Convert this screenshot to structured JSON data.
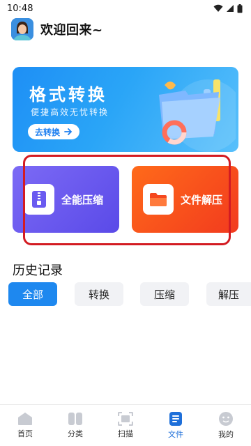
{
  "status_bar": {
    "time": "10:48"
  },
  "header": {
    "greeting": "欢迎回来~"
  },
  "banner": {
    "title": "格式转换",
    "subtitle": "便捷高效无忧转换",
    "cta_label": "去转换"
  },
  "features": [
    {
      "label": "全能压缩",
      "icon": "zip-file-icon"
    },
    {
      "label": "文件解压",
      "icon": "folder-icon"
    }
  ],
  "history": {
    "title": "历史记录",
    "filters": [
      "全部",
      "转换",
      "压缩",
      "解压"
    ],
    "active_filter": "全部"
  },
  "bottom_nav": {
    "items": [
      {
        "label": "首页",
        "icon": "home-icon"
      },
      {
        "label": "分类",
        "icon": "category-icon"
      },
      {
        "label": "扫描",
        "icon": "scan-icon"
      },
      {
        "label": "文件",
        "icon": "file-icon"
      },
      {
        "label": "我的",
        "icon": "profile-icon"
      }
    ],
    "active": "文件"
  },
  "colors": {
    "accent": "#1e88ef",
    "compress_card": "#6a5af0",
    "extract_card": "#f5481e",
    "highlight": "#d31b22"
  }
}
